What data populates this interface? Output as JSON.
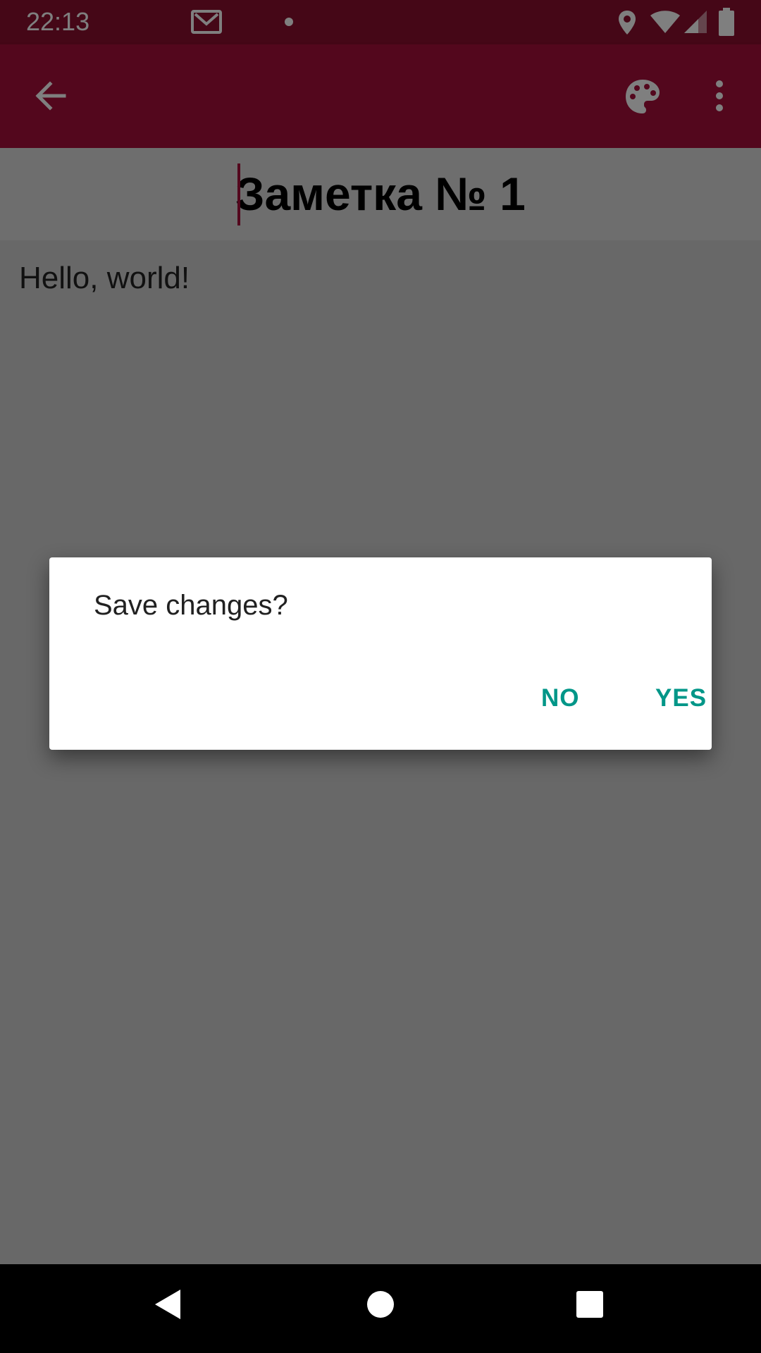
{
  "status_bar": {
    "time": "22:13",
    "icons": [
      "gmail-icon",
      "notification-dot-icon",
      "location-icon",
      "wifi-icon",
      "signal-icon",
      "battery-icon"
    ]
  },
  "app_bar": {
    "icons": [
      "back-arrow-icon",
      "palette-icon",
      "more-vert-icon"
    ],
    "color": "#a70f3a"
  },
  "note": {
    "title": "Заметка № 1",
    "body": "Hello, world!"
  },
  "dialog": {
    "message": "Save changes?",
    "no_label": "NO",
    "yes_label": "YES",
    "button_color": "#009688"
  },
  "nav_bar": {
    "icons": [
      "nav-back-icon",
      "nav-home-icon",
      "nav-recents-icon"
    ]
  }
}
